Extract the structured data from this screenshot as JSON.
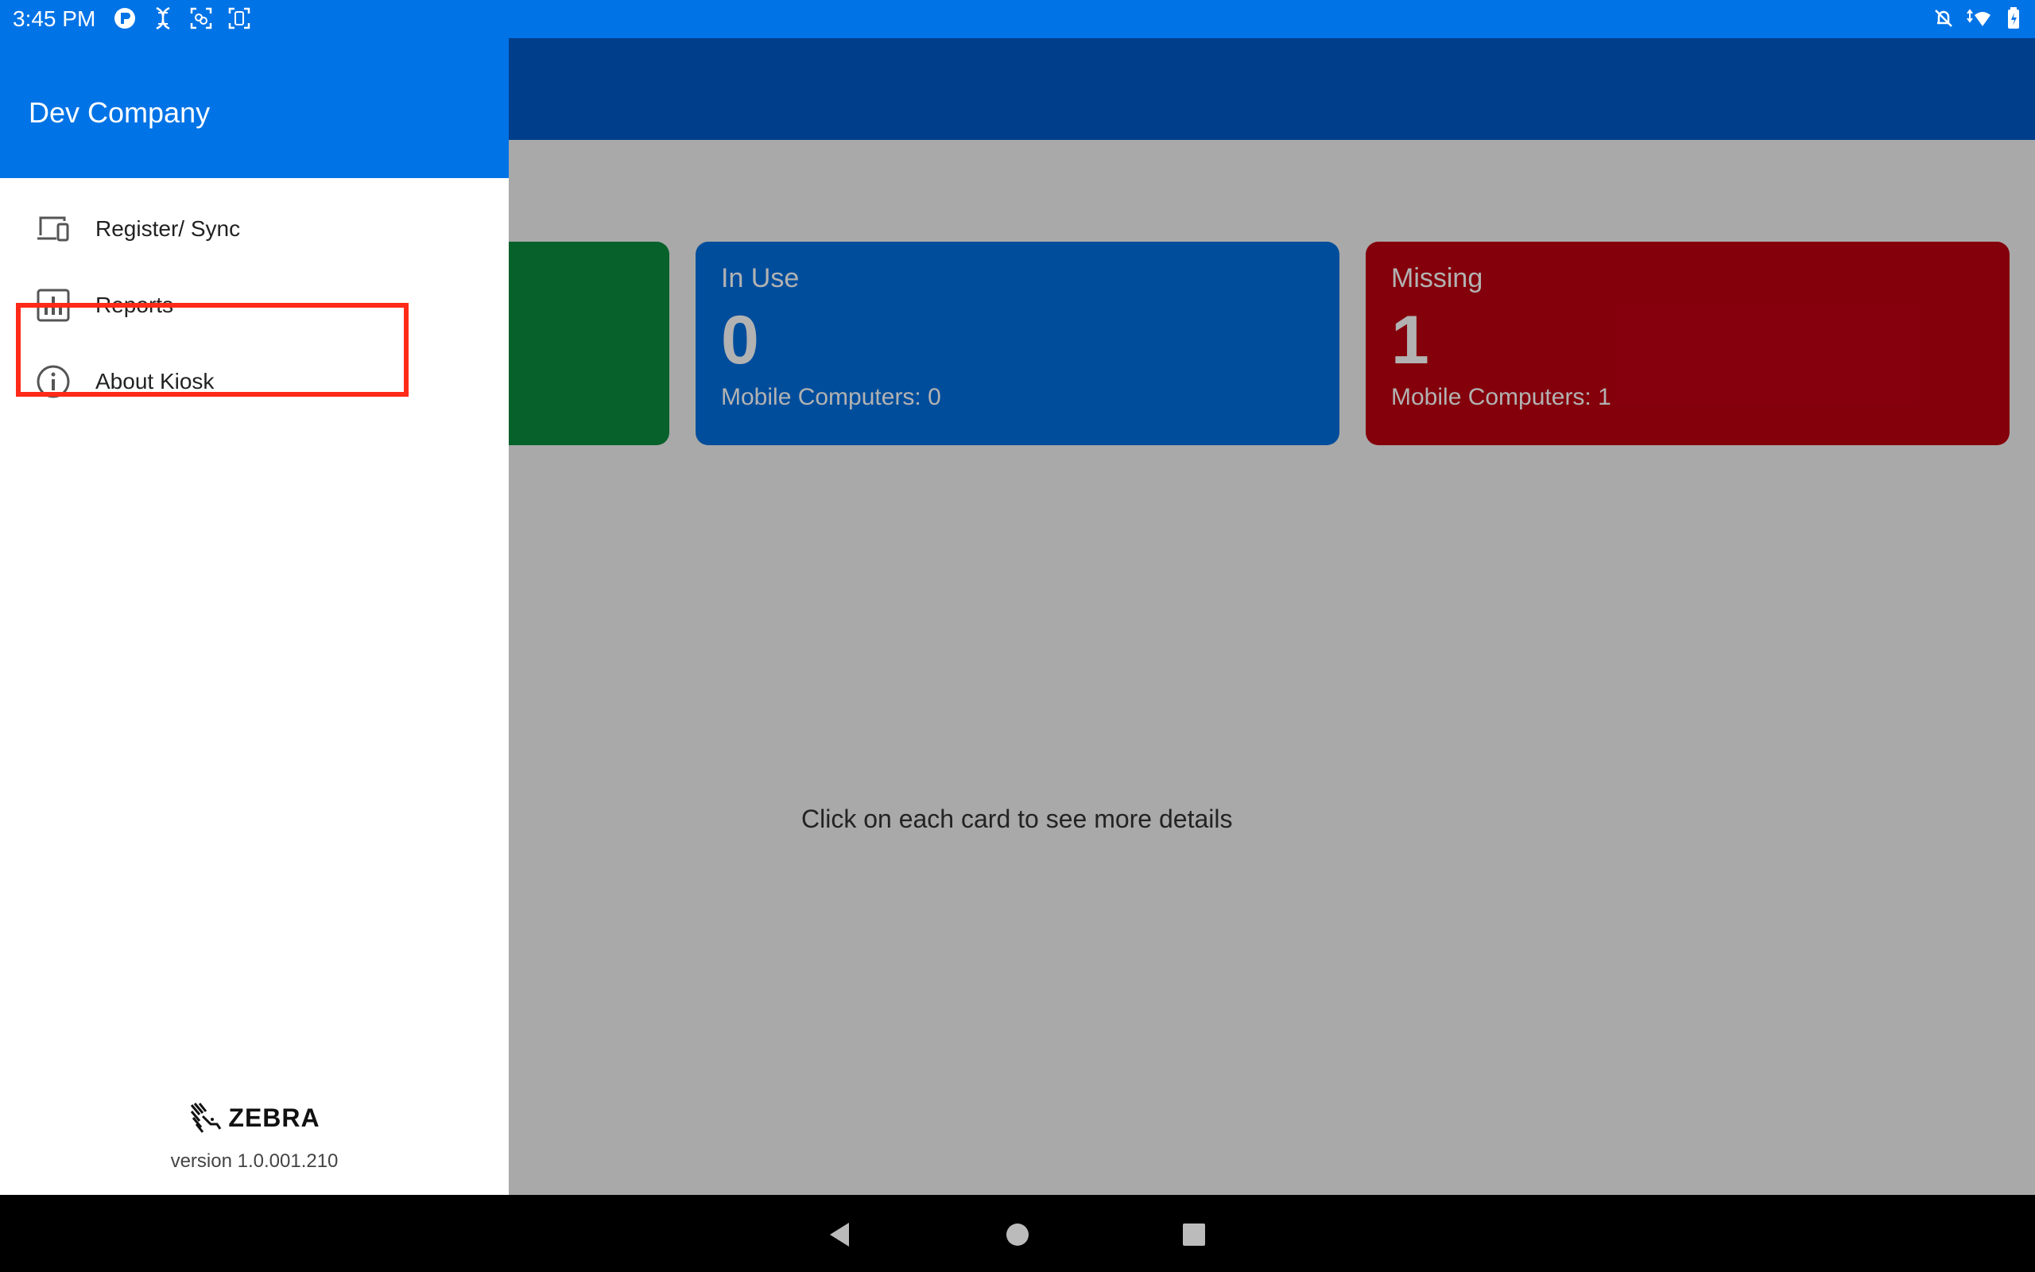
{
  "status_bar": {
    "time": "3:45 PM",
    "left_icons": [
      "app-notification-icon",
      "dna-icon",
      "scan-icon",
      "device-icon"
    ],
    "right_icons": [
      "silent-icon",
      "wifi-icon",
      "battery-icon"
    ]
  },
  "drawer": {
    "company": "Dev Company",
    "items": [
      {
        "label": "Register/ Sync",
        "icon": "devices-icon"
      },
      {
        "label": "Reports",
        "icon": "bar-chart-icon"
      },
      {
        "label": "About Kiosk",
        "icon": "info-icon"
      }
    ],
    "brand": "ZEBRA",
    "version": "version 1.0.001.210"
  },
  "cards": [
    {
      "title": "",
      "value": "",
      "sub": "",
      "color": "#0B8B3E"
    },
    {
      "title": "In Use",
      "value": "0",
      "sub": "Mobile Computers: 0",
      "color": "#006FE0"
    },
    {
      "title": "Missing",
      "value": "1",
      "sub": "Mobile Computers: 1",
      "color": "#BE0011"
    }
  ],
  "hint": "Click on each card to see more details",
  "colors": {
    "status_bar": "#0073E6",
    "toolbar": "#0059C9",
    "highlight": "#FF2A17"
  }
}
